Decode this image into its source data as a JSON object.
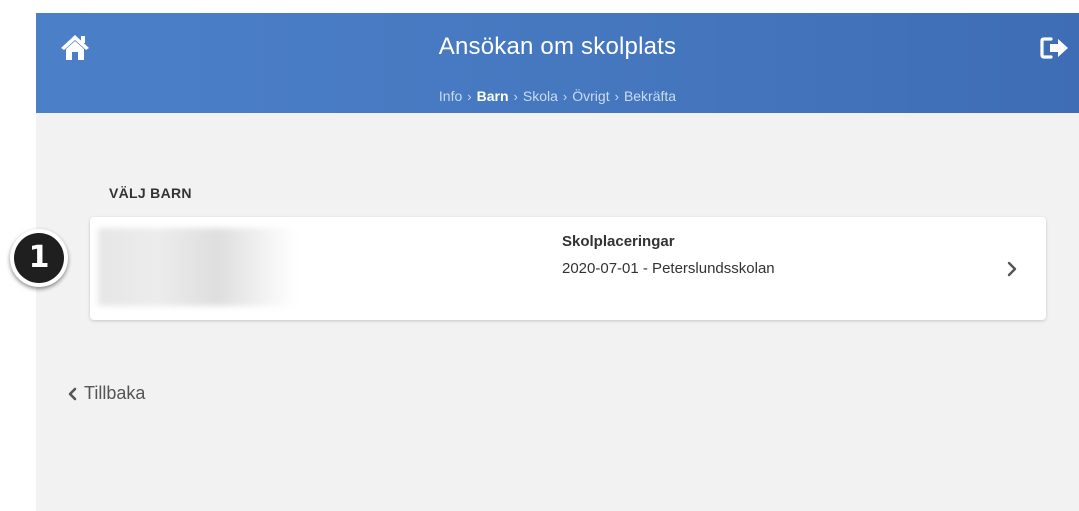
{
  "header": {
    "title": "Ansökan om skolplats",
    "home_icon": "home-icon",
    "logout_icon": "sign-out-icon",
    "breadcrumb": [
      {
        "label": "Info",
        "active": false
      },
      {
        "label": "Barn",
        "active": true
      },
      {
        "label": "Skola",
        "active": false
      },
      {
        "label": "Övrigt",
        "active": false
      },
      {
        "label": "Bekräfta",
        "active": false
      }
    ],
    "breadcrumb_separator": "›"
  },
  "main": {
    "section_heading": "VÄLJ BARN",
    "child_card": {
      "placement_label": "Skolplaceringar",
      "placement_value": "2020-07-01 - Peterslundsskolan"
    },
    "back_label": "Tillbaka"
  },
  "annotation": {
    "badge_number": "1"
  },
  "colors": {
    "header_gradient_start": "#4b80c8",
    "header_gradient_end": "#3e6db5",
    "background": "#f2f2f2",
    "card": "#ffffff",
    "text": "#333333"
  }
}
